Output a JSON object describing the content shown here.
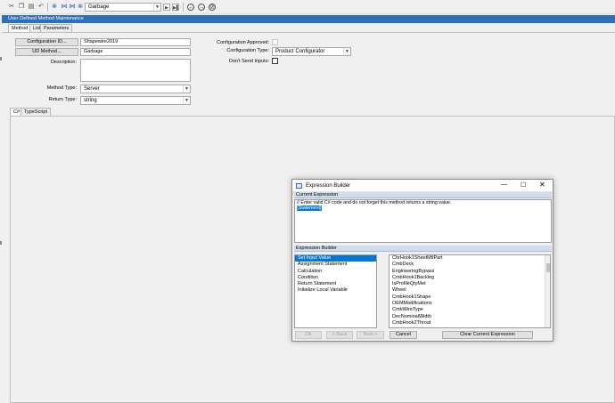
{
  "toolbar": {
    "record_value": "Garbage",
    "icons": [
      "scissors-icon",
      "copy-icon",
      "paste-icon",
      "undo-icon",
      "binoculars-icon",
      "first-icon",
      "last-icon",
      "binoculars-icon",
      "record-combo",
      "chevron-down-icon",
      "next-record-icon",
      "nav-back-icon",
      "nav-forward-icon",
      "clear-icon"
    ]
  },
  "window": {
    "title": "User Defined Method Maintenance"
  },
  "tabs": [
    "Method",
    "List",
    "Parameters"
  ],
  "form": {
    "config_id_button": "Configuration ID...",
    "config_id_value": "Shapewire2019",
    "ud_method_button": "UD Method...",
    "ud_method_value": "Garbage",
    "description_label": "Description:",
    "description_value": "",
    "method_type_label": "Method Type:",
    "method_type_value": "Server",
    "return_type_label": "Return Type:",
    "return_type_value": "string",
    "config_approved_label": "Configuration Approved:",
    "config_type_label": "Configuration Type:",
    "config_type_value": "Product Configurator",
    "dont_send_label": "Don't Send Inputs:"
  },
  "code_tabs": [
    "C#",
    "TypeScript"
  ],
  "dialog": {
    "title": "Expression Builder",
    "current_expression_header": "Current Expression",
    "expression_line1": "// Enter valid C# code and do not forget this method returns a string value.",
    "expression_line2": "{Statement}",
    "builder_header": "Expression Builder",
    "left_items": [
      "Set Input Value",
      "Assignment Statement",
      "Calculation",
      "Condition",
      "Return Statement",
      "Initialize Local Variable"
    ],
    "right_items": [
      "ChrHook1SheetMtlPart",
      "CmbDeck",
      "EngineeringBypass",
      "CmbHook1Backleg",
      "IsProfileQtyMet",
      "Wheel",
      "CmbHook1Shape",
      "OEMModifications",
      "CmbWireType",
      "DecNominalWidth",
      "CmbHook2Throat"
    ],
    "buttons": {
      "ok": "Ok",
      "back": "< Back",
      "next": "Next >",
      "cancel": "Cancel",
      "clear": "Clear Current Expression"
    }
  },
  "colors": {
    "titlebar": "#2d6fb8",
    "selection": "#0078d7",
    "section_header": "#cfdcec"
  }
}
